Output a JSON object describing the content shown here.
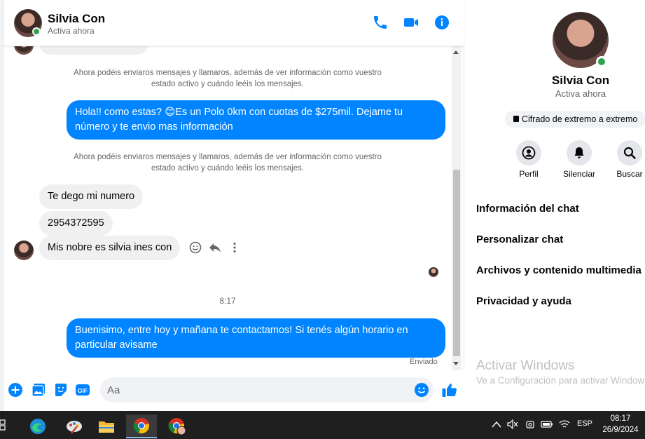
{
  "contact": {
    "name": "Silvia Con",
    "status": "Activa ahora"
  },
  "header_icons": [
    "phone-icon",
    "video-icon",
    "info-icon"
  ],
  "system_notes": [
    "Ahora podéis enviaros mensajes y llamaros, además de ver información como vuestro estado activo y cuándo leéis los mensajes.",
    "Ahora podéis enviaros mensajes y llamaros, además de ver información como vuestro estado activo y cuándo leéis los mensajes."
  ],
  "messages": [
    {
      "direction": "out",
      "text": "Hola!! como estas? 😊Es un Polo 0km con cuotas de $275mil. Dejame tu número y te envio mas información"
    },
    {
      "direction": "in",
      "text": "Te dego mi numero"
    },
    {
      "direction": "in",
      "text": "2954372595"
    },
    {
      "direction": "in",
      "text": "Mis nobre es silvia ines con"
    },
    {
      "direction": "out",
      "text": "Buenisimo, entre hoy y mañana te contactamos! Si tenés algún horario en particular avisame"
    }
  ],
  "time_separator": "8:17",
  "sent_status": "Enviado",
  "composer": {
    "placeholder": "Aa",
    "icons": [
      "plus-icon",
      "photo-icon",
      "sticker-icon",
      "gif-icon",
      "emoji-icon",
      "like-icon"
    ]
  },
  "info_panel": {
    "name": "Silvia Con",
    "status": "Activa ahora",
    "encryption": "Cifrado de extremo a extremo",
    "actions": [
      {
        "label": "Perfil",
        "icon": "profile-icon"
      },
      {
        "label": "Silenciar",
        "icon": "bell-icon"
      },
      {
        "label": "Buscar",
        "icon": "search-icon"
      }
    ],
    "menu": [
      "Información del chat",
      "Personalizar chat",
      "Archivos y contenido multimedia",
      "Privacidad y ayuda"
    ]
  },
  "watermark": {
    "line1": "Activar Windows",
    "line2": "Ve a Configuración para activar Windows."
  },
  "taskbar": {
    "lang": "ESP",
    "time": "08:17",
    "date": "26/9/2024"
  },
  "colors": {
    "accent": "#0084ff",
    "online": "#31a24c",
    "incoming_bubble": "#f0f0f0"
  }
}
